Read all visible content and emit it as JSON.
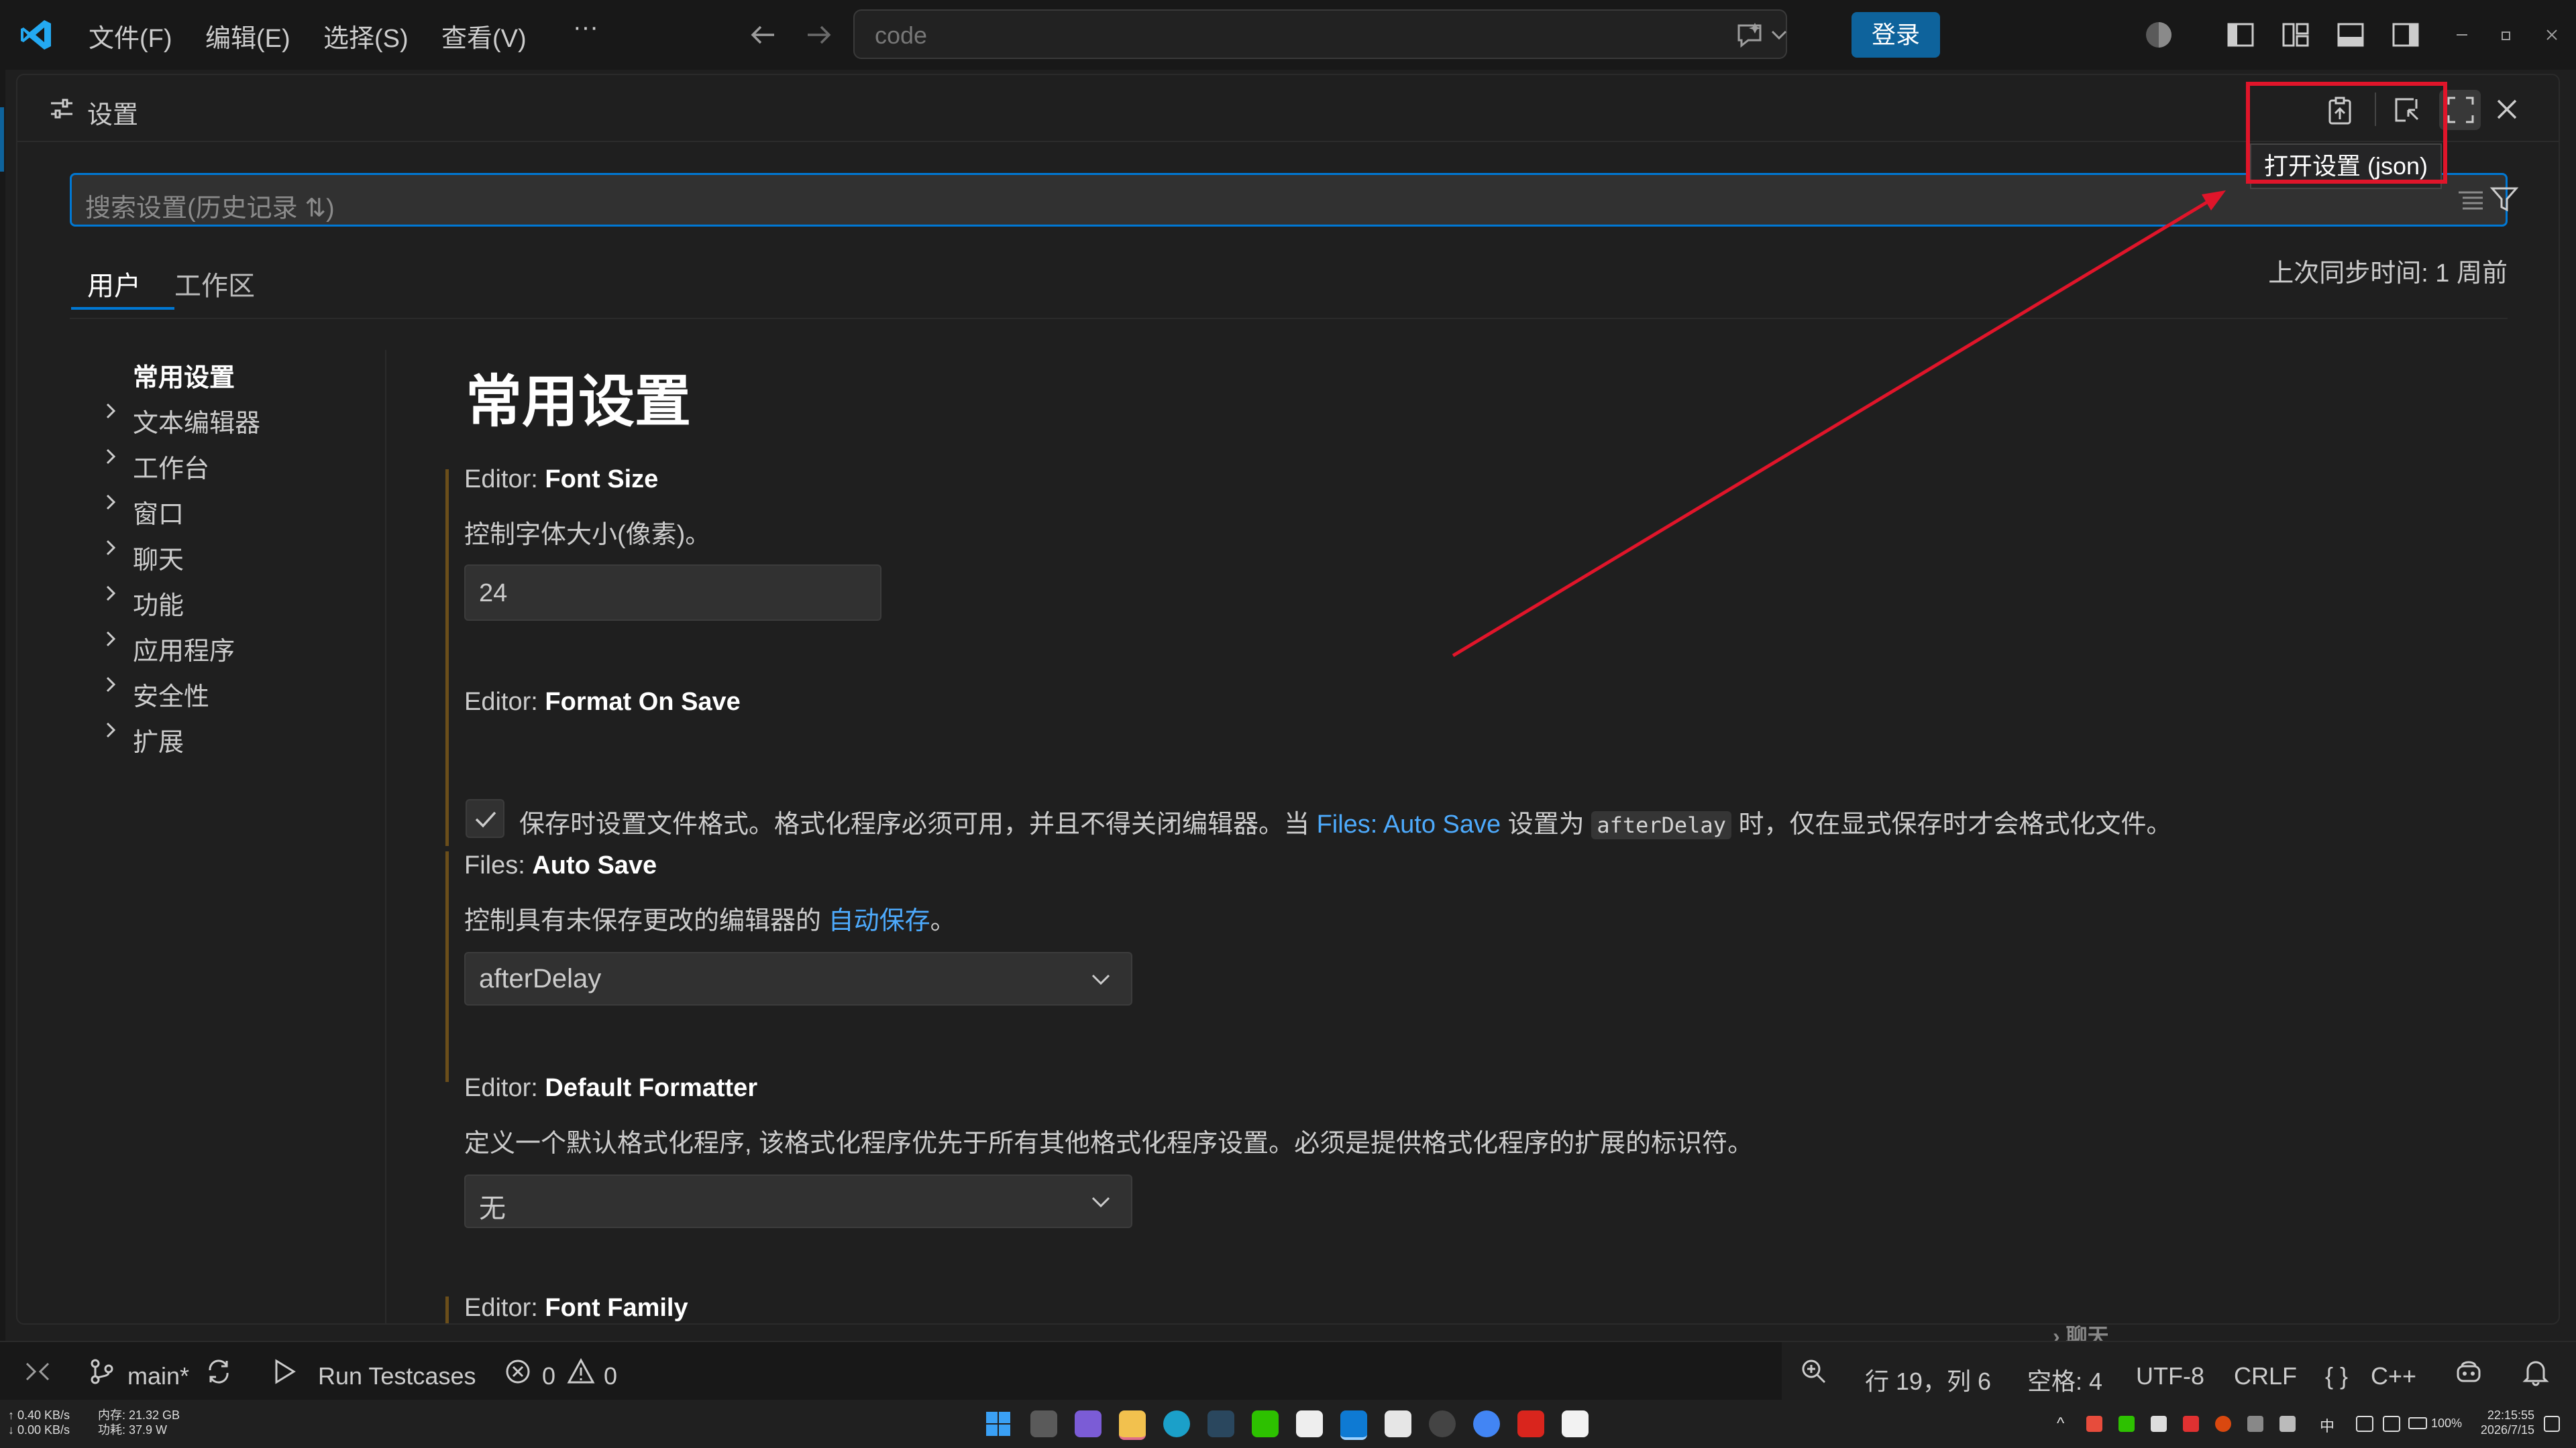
{
  "titlebar": {
    "menu": [
      "文件(F)",
      "编辑(E)",
      "选择(S)",
      "查看(V)"
    ],
    "more": "···",
    "command_center": "code",
    "login": "登录"
  },
  "settings": {
    "title": "设置",
    "search_placeholder": "搜索设置(历史记录 ⇅)",
    "tabs": [
      "用户",
      "工作区"
    ],
    "sync_status": "上次同步时间: 1 周前",
    "tooltip": "打开设置 (json)",
    "toc": {
      "active": "常用设置",
      "items": [
        "文本编辑器",
        "工作台",
        "窗口",
        "聊天",
        "功能",
        "应用程序",
        "安全性",
        "扩展"
      ]
    },
    "heading": "常用设置",
    "items": {
      "font_size": {
        "prefix": "Editor:",
        "name": "Font Size",
        "desc": "控制字体大小(像素)。",
        "value": "24"
      },
      "format_on_save": {
        "prefix": "Editor:",
        "name": "Format On Save",
        "desc_1": "保存时设置文件格式。格式化程序必须可用，并且不得关闭编辑器。当",
        "link": "Files: Auto Save",
        "desc_2": "设置为",
        "code": "afterDelay",
        "desc_3": "时，仅在显式保存时才会格式化文件。",
        "checked": true
      },
      "auto_save": {
        "prefix": "Files:",
        "name": "Auto Save",
        "desc_1": "控制具有未保存更改的编辑器的",
        "link": "自动保存",
        "desc_2": "。",
        "value": "afterDelay"
      },
      "default_formatter": {
        "prefix": "Editor:",
        "name": "Default Formatter",
        "desc": "定义一个默认格式化程序, 该格式化程序优先于所有其他格式化程序设置。必须是提供格式化程序的扩展的标识符。",
        "value": "无"
      },
      "font_family": {
        "prefix": "Editor:",
        "name": "Font Family"
      }
    },
    "peek_behind": "聊天"
  },
  "statusbar": {
    "branch": "main*",
    "run": "Run Testcases",
    "errors": "0",
    "warnings": "0",
    "position": "行 19，列 6",
    "spaces": "空格: 4",
    "encoding": "UTF-8",
    "eol": "CRLF",
    "language": "C++"
  },
  "taskbar": {
    "net_up": "↑ 0.40 KB/s",
    "net_down": "↓ 0.00 KB/s",
    "memory": "内存: 21.32 GB",
    "power": "功耗: 37.9 W",
    "battery": "100%",
    "time": "22:15:55",
    "date": "2026/7/15"
  },
  "colors": {
    "accent": "#0078d4",
    "link": "#4daafc",
    "annotation": "#e0152a",
    "modified_bar": "#6b4e1a"
  }
}
